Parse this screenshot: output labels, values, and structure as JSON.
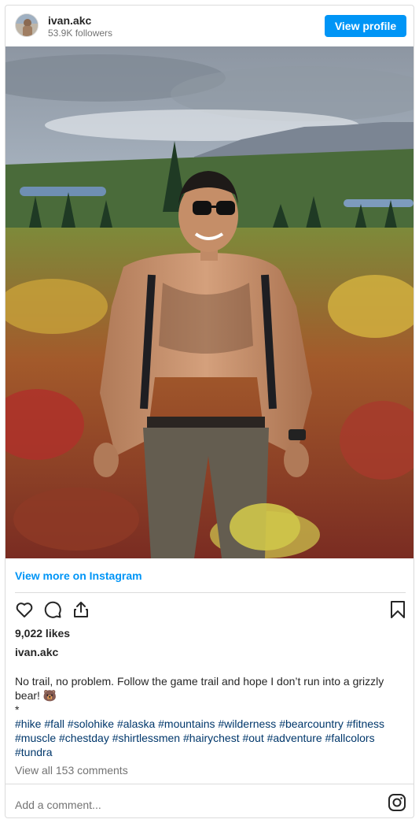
{
  "header": {
    "username": "ivan.akc",
    "followers": "53.9K followers",
    "view_profile": "View profile"
  },
  "post": {
    "view_more": "View more on Instagram",
    "likes": "9,022 likes",
    "owner": "ivan.akc",
    "caption": "No trail, no problem. Follow the game trail and hope I don’t run into a grizzly bear! 🐻",
    "separator": "*",
    "hashtags": "#hike #fall #solohike #alaska #mountains #wilderness #bearcountry #fitness #muscle #chestday #shirtlessmen #hairychest #out #adventure #fallcolors #tundra",
    "view_comments": "View all 153 comments",
    "add_comment_placeholder": "Add a comment..."
  },
  "icons": {
    "like": "heart-icon",
    "comment": "comment-icon",
    "share": "share-icon",
    "save": "bookmark-icon",
    "brand": "instagram-icon"
  },
  "colors": {
    "accent": "#0095f6",
    "hashtag": "#00376b",
    "muted": "#737373",
    "border": "#dbdbdb"
  }
}
